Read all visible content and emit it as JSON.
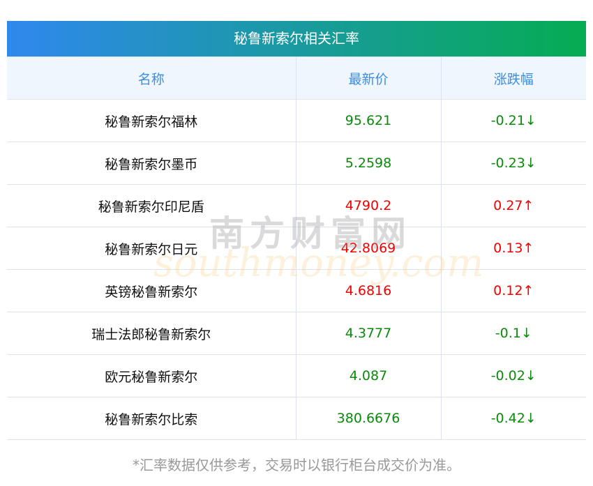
{
  "title": "秘鲁新索尔相关汇率",
  "headers": [
    "名称",
    "最新价",
    "涨跌幅"
  ],
  "rows": [
    {
      "name": "秘鲁新索尔福林",
      "price": "95.621",
      "change": "-0.21↓",
      "dir": "down"
    },
    {
      "name": "秘鲁新索尔墨币",
      "price": "5.2598",
      "change": "-0.23↓",
      "dir": "down"
    },
    {
      "name": "秘鲁新索尔印尼盾",
      "price": "4790.2",
      "change": "0.27↑",
      "dir": "up"
    },
    {
      "name": "秘鲁新索尔日元",
      "price": "42.8069",
      "change": "0.13↑",
      "dir": "up"
    },
    {
      "name": "英镑秘鲁新索尔",
      "price": "4.6816",
      "change": "0.12↑",
      "dir": "up"
    },
    {
      "name": "瑞士法郎秘鲁新索尔",
      "price": "4.3777",
      "change": "-0.1↓",
      "dir": "down"
    },
    {
      "name": "欧元秘鲁新索尔",
      "price": "4.087",
      "change": "-0.02↓",
      "dir": "down"
    },
    {
      "name": "秘鲁新索尔比索",
      "price": "380.6676",
      "change": "-0.42↓",
      "dir": "down"
    }
  ],
  "footer": "*汇率数据仅供参考，交易时以银行柜台成交价为准。",
  "watermark": {
    "cn": "南方财富网",
    "en": "southmoney.com"
  },
  "colors": {
    "up": "#f40000",
    "down": "#0a8a0a",
    "header_text": "#3a8ee6"
  }
}
